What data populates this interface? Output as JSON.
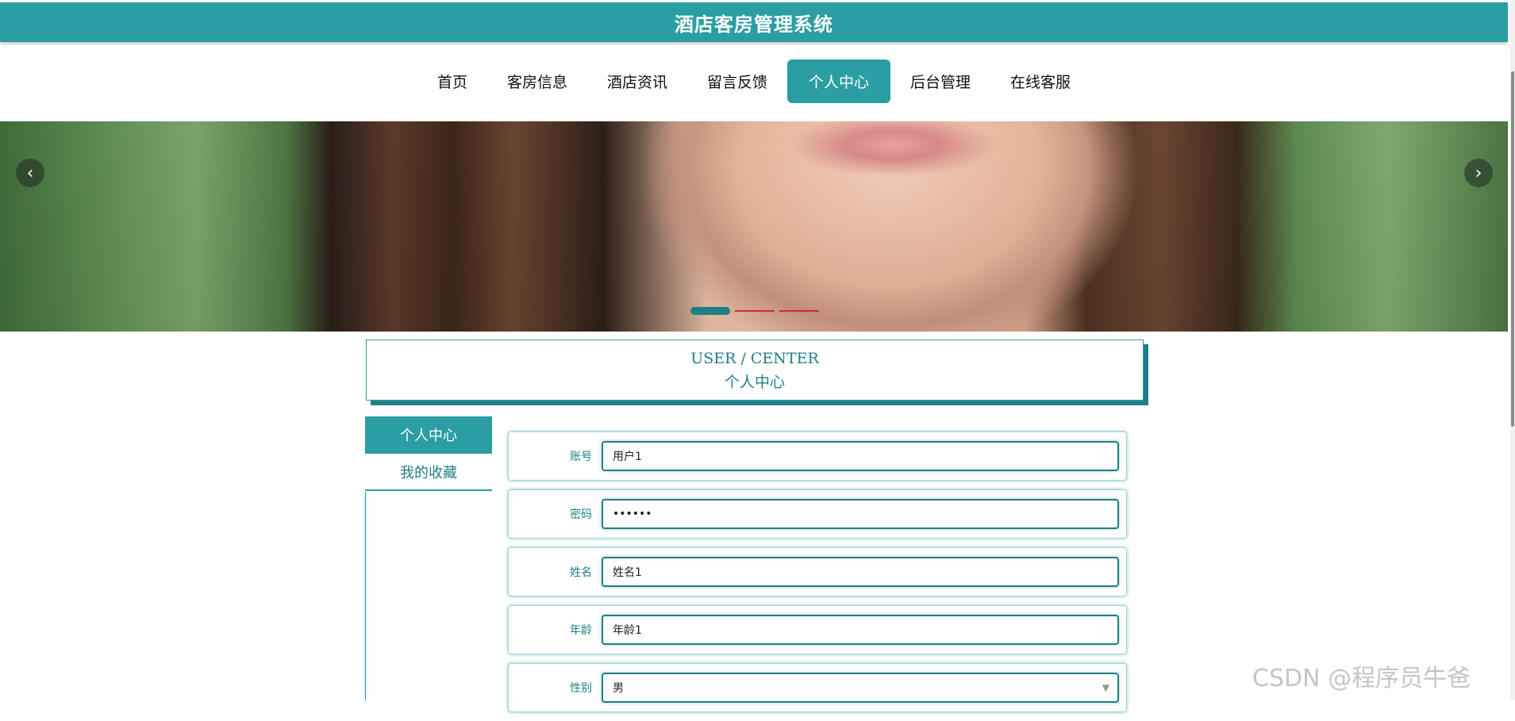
{
  "header": {
    "title": "酒店客房管理系统"
  },
  "nav": {
    "items": [
      {
        "label": "首页"
      },
      {
        "label": "客房信息"
      },
      {
        "label": "酒店资讯"
      },
      {
        "label": "留言反馈"
      },
      {
        "label": "个人中心",
        "active": true
      },
      {
        "label": "后台管理"
      },
      {
        "label": "在线客服"
      }
    ]
  },
  "banner": {
    "slide_count": 3,
    "active_slide": 1,
    "prev_icon": "chevron-left-icon",
    "next_icon": "chevron-right-icon"
  },
  "section": {
    "title_en": "USER / CENTER",
    "title_zh": "个人中心"
  },
  "sidebar": {
    "items": [
      {
        "label": "个人中心",
        "active": true
      },
      {
        "label": "我的收藏"
      }
    ]
  },
  "form": {
    "fields": [
      {
        "label": "账号",
        "value": "用户1"
      },
      {
        "label": "密码",
        "value": "••••••"
      },
      {
        "label": "姓名",
        "value": "姓名1"
      },
      {
        "label": "年龄",
        "value": "年龄1"
      },
      {
        "label": "性别",
        "value": "男"
      }
    ]
  },
  "watermark": "CSDN @程序员牛爸",
  "colors": {
    "primary": "#2a9ea3",
    "primary_dark": "#1f7f86",
    "dot_inactive": "#d42b2b"
  }
}
